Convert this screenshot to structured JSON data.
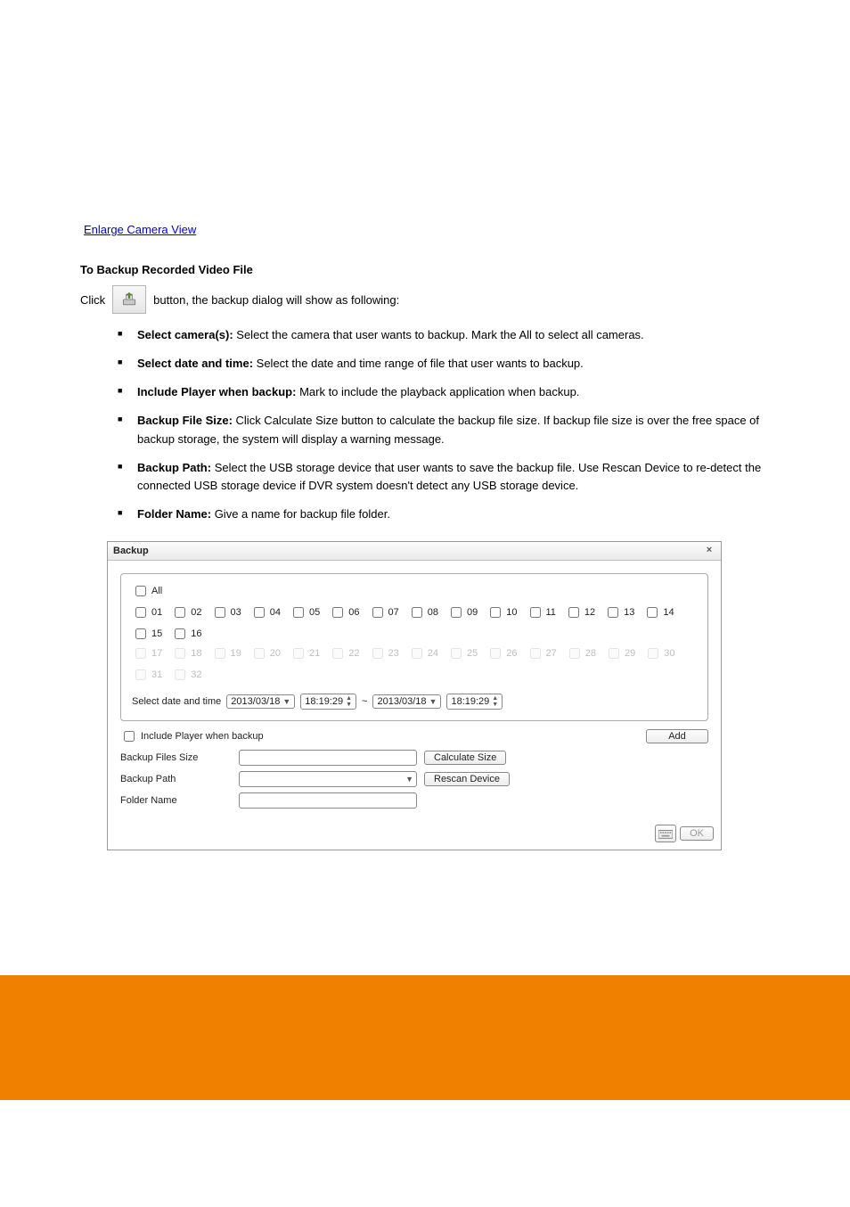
{
  "page": {
    "link_text": "Enlarge Camera View",
    "section_heading": "To Backup Recorded Video File",
    "icon_click_text_before": "Click",
    "icon_click_text_after": " button, the backup dialog will show as following:",
    "icon_name": "backup-icon"
  },
  "bullets": [
    {
      "bold": "Select camera(s):",
      "rest": " Select the camera that user wants to backup. Mark the All to select all cameras."
    },
    {
      "bold": "Select date and time:",
      "rest": " Select the date and time range of file that user wants to backup."
    },
    {
      "bold": "Include Player when backup:",
      "rest": " Mark to include the playback application when backup."
    },
    {
      "bold": "Backup File Size:",
      "rest": " Click Calculate Size button to calculate the backup file size. If backup file size is over the free space of backup storage, the system will display a warning message."
    },
    {
      "bold": "Backup Path:",
      "rest": " Select the USB storage device that user wants to save the backup file. Use Rescan Device to re-detect the connected USB storage device if DVR system doesn't detect any USB storage device."
    },
    {
      "bold": "Folder Name:",
      "rest": " Give a name for backup file folder."
    }
  ],
  "dialog": {
    "title": "Backup",
    "close_glyph": "×",
    "all_label": "All",
    "active_channels": [
      "01",
      "02",
      "03",
      "04",
      "05",
      "06",
      "07",
      "08",
      "09",
      "10",
      "11",
      "12",
      "13",
      "14",
      "15",
      "16"
    ],
    "disabled_channels": [
      "17",
      "18",
      "19",
      "20",
      "21",
      "22",
      "23",
      "24",
      "25",
      "26",
      "27",
      "28",
      "29",
      "30",
      "31",
      "32"
    ],
    "select_dt_label": "Select date and time",
    "date1": "2013/03/18",
    "time1": "18:19:29",
    "tilde": "~",
    "date2": "2013/03/18",
    "time2": "18:19:29",
    "include_player_label": "Include Player when backup",
    "add_label": "Add",
    "backup_size_label": "Backup Files Size",
    "calc_label": "Calculate Size",
    "backup_path_label": "Backup Path",
    "rescan_label": "Rescan Device",
    "folder_label": "Folder Name",
    "ok_label": "OK"
  }
}
